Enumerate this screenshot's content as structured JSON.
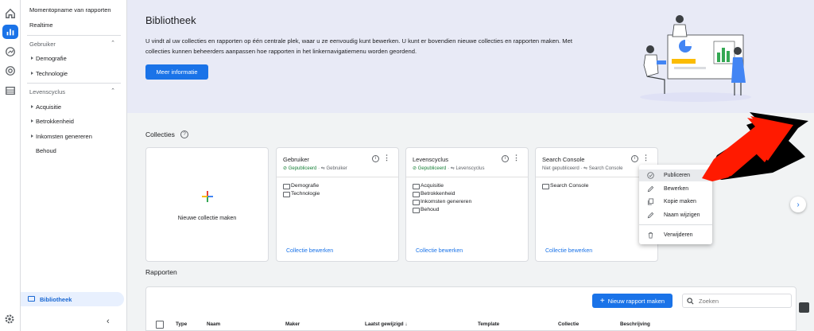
{
  "rail": {
    "icons": [
      "home-icon",
      "reports-icon",
      "explore-icon",
      "advertising-icon",
      "configure-icon",
      "settings-icon"
    ]
  },
  "sidebar": {
    "snapshot": "Momentopname van rapporten",
    "realtime": "Realtime",
    "section_user": "Gebruiker",
    "demografie": "Demografie",
    "technologie": "Technologie",
    "section_lifecycle": "Levenscyclus",
    "acquisitie": "Acquisitie",
    "betrokkenheid": "Betrokkenheid",
    "inkomsten": "Inkomsten genereren",
    "behoud": "Behoud",
    "library": "Bibliotheek"
  },
  "hero": {
    "title": "Bibliotheek",
    "description": "U vindt al uw collecties en rapporten op één centrale plek, waar u ze eenvoudig kunt bewerken. U kunt er bovendien nieuwe collecties en rapporten maken. Met collecties kunnen beheerders aanpassen hoe rapporten in het linkernavigatiemenu worden geordend.",
    "button": "Meer informatie"
  },
  "collections": {
    "heading": "Collecties",
    "new_label": "Nieuwe collectie maken",
    "edit_label": "Collectie bewerken",
    "cards": [
      {
        "title": "Gebruiker",
        "status": "Gepubliceerd",
        "template": "Gebruiker",
        "items": [
          "Demografie",
          "Technologie"
        ]
      },
      {
        "title": "Levenscyclus",
        "status": "Gepubliceerd",
        "template": "Levenscyclus",
        "items": [
          "Acquisitie",
          "Betrokkenheid",
          "Inkomsten genereren",
          "Behoud"
        ]
      },
      {
        "title": "Search Console",
        "status": "Niet gepubliceerd",
        "template": "Search Console",
        "items": [
          "Search Console"
        ]
      }
    ]
  },
  "menu": {
    "items": [
      "Publiceren",
      "Bewerken",
      "Kopie maken",
      "Naam wijzigen",
      "Verwijderen"
    ]
  },
  "reports": {
    "heading": "Rapporten",
    "new_button": "Nieuw rapport maken",
    "search_placeholder": "Zoeken",
    "columns": [
      "Type",
      "Naam",
      "Maker",
      "Laatst gewijzigd",
      "Template",
      "Collectie",
      "Beschrijving"
    ]
  },
  "colors": {
    "primary": "#1a73e8",
    "success": "#188038",
    "arrow": "#ff1a00",
    "hero_bg": "#e8eaf6"
  }
}
